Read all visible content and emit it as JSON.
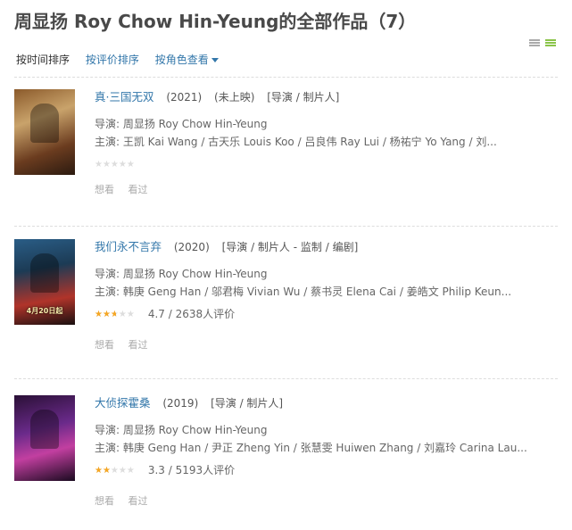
{
  "page_title": "周显扬 Roy Chow Hin-Yeung的全部作品（7）",
  "sort": {
    "by_time": "按时间排序",
    "by_rating": "按评价排序",
    "by_role": "按角色查看"
  },
  "view_icons": [
    "list-view-icon",
    "detail-view-icon"
  ],
  "colors": {
    "link": "#3377aa",
    "star": "#f5a623",
    "title": "#494949"
  },
  "items": [
    {
      "title": "真·三国无双",
      "year": "(2021)",
      "status": "(未上映)",
      "roles": "[导演 / 制片人]",
      "director": "导演: 周显扬 Roy Chow Hin-Yeung",
      "cast": "主演: 王凯 Kai Wang / 古天乐 Louis Koo / 吕良伟 Ray Lui / 杨祐宁 Yo Yang / 刘...",
      "rating_fraction": 0,
      "rating_text": "",
      "want": "想看",
      "seen": "看过"
    },
    {
      "title": "我们永不言弃",
      "year": "(2020)",
      "status": "",
      "roles": "[导演 / 制片人 - 监制 / 编剧]",
      "director": "导演: 周显扬 Roy Chow Hin-Yeung",
      "cast": "主演: 韩庚 Geng Han / 邬君梅 Vivian Wu / 蔡书灵 Elena Cai / 姜皓文 Philip Keun...",
      "poster_text": "4月20日起",
      "rating_fraction": 0.47,
      "rating_text": "4.7 / 2638人评价",
      "want": "想看",
      "seen": "看过"
    },
    {
      "title": "大侦探霍桑",
      "year": "(2019)",
      "status": "",
      "roles": "[导演 / 制片人]",
      "director": "导演: 周显扬 Roy Chow Hin-Yeung",
      "cast": "主演: 韩庚 Geng Han / 尹正 Zheng Yin / 张慧雯 Huiwen Zhang / 刘嘉玲 Carina Lau...",
      "rating_fraction": 0.33,
      "rating_text": "3.3 / 5193人评价",
      "want": "想看",
      "seen": "看过"
    }
  ]
}
